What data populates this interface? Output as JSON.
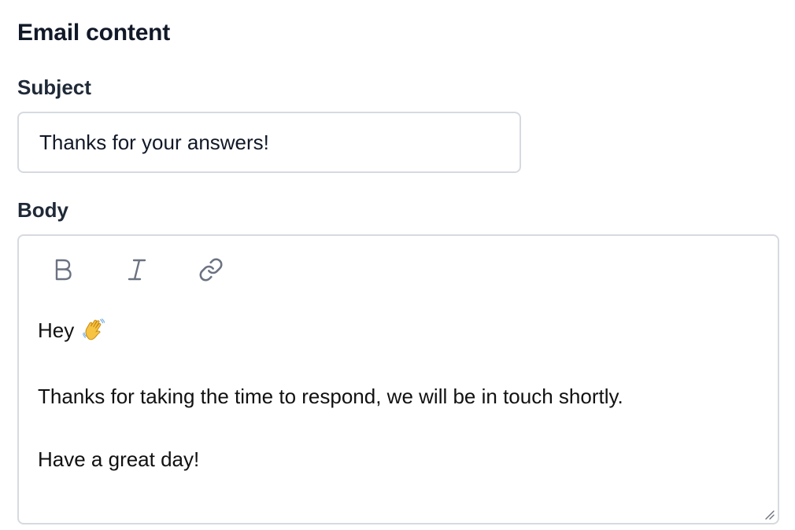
{
  "section": {
    "title": "Email content"
  },
  "subject": {
    "label": "Subject",
    "value": "Thanks for your answers!"
  },
  "body": {
    "label": "Body",
    "toolbar": [
      {
        "name": "bold",
        "icon": "bold-icon"
      },
      {
        "name": "italic",
        "icon": "italic-icon"
      },
      {
        "name": "link",
        "icon": "link-icon"
      }
    ],
    "greeting": "Hey",
    "greeting_emoji": "waving-hand-icon",
    "paragraph": "Thanks for taking the time to respond, we will be in touch shortly.",
    "signoff": "Have a great day!"
  },
  "colors": {
    "border": "#d6dae0",
    "text": "#111827",
    "icon": "#6b7280"
  }
}
